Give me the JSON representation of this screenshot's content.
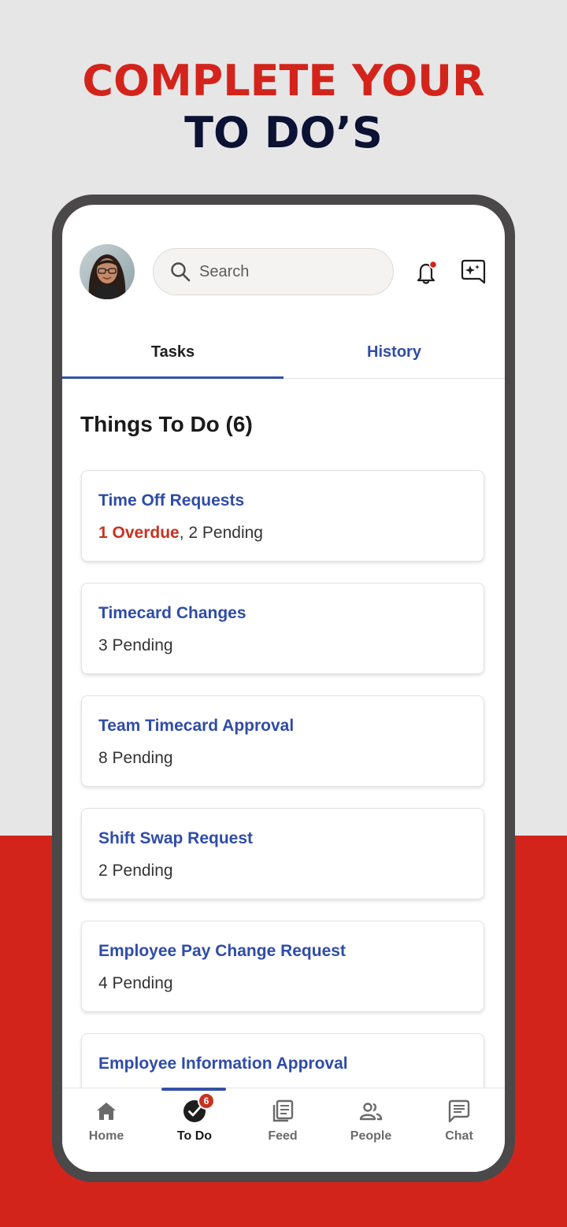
{
  "promo": {
    "headline_line1": "COMPLETE YOUR",
    "headline_line2": "TO DO’S"
  },
  "header": {
    "search_placeholder": "Search",
    "icons": [
      "avatar",
      "search-icon",
      "bell-icon",
      "ai-sparkle-icon"
    ],
    "notification_dot_color": "#d3241c"
  },
  "tabs": [
    {
      "label": "Tasks",
      "active": true
    },
    {
      "label": "History",
      "active": false
    }
  ],
  "section": {
    "title": "Things To Do (6)"
  },
  "cards": [
    {
      "title": "Time Off Requests",
      "overdue": "1 Overdue",
      "separator": ",",
      "pending": " 2 Pending"
    },
    {
      "title": "Timecard Changes",
      "pending": "3 Pending"
    },
    {
      "title": "Team Timecard Approval",
      "pending": "8 Pending"
    },
    {
      "title": "Shift Swap Request",
      "pending": "2 Pending"
    },
    {
      "title": "Employee Pay Change Request",
      "pending": "4 Pending"
    },
    {
      "title": "Employee Information Approval",
      "pending": ""
    }
  ],
  "bottom_nav": [
    {
      "label": "Home",
      "icon": "home-icon"
    },
    {
      "label": "To Do",
      "icon": "check-circle-icon",
      "active": true,
      "badge": "6"
    },
    {
      "label": "Feed",
      "icon": "feed-icon"
    },
    {
      "label": "People",
      "icon": "people-icon"
    },
    {
      "label": "Chat",
      "icon": "chat-icon"
    }
  ],
  "colors": {
    "brand_red": "#d3241c",
    "navy": "#0b1233",
    "accent_blue": "#2f4ca8",
    "background_gray": "#e6e6e7"
  }
}
